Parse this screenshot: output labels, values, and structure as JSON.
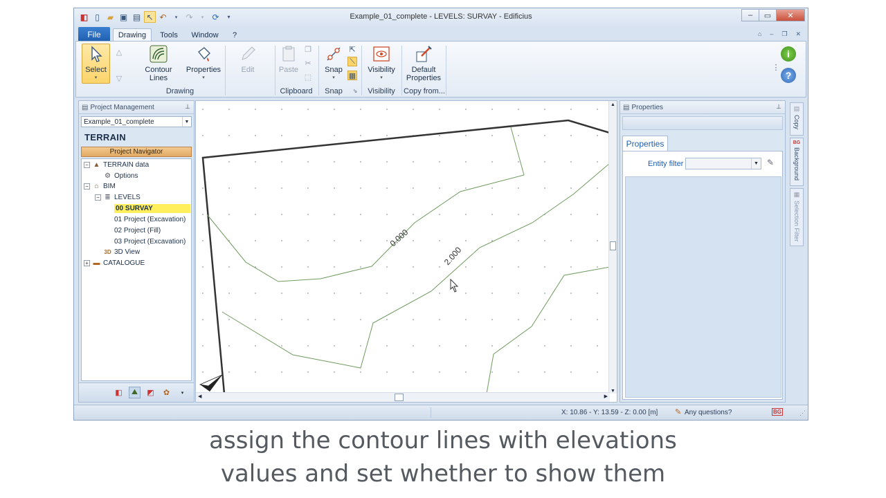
{
  "window": {
    "title": "Example_01_complete -  LEVELS: SURVAY - Edificius"
  },
  "menu": {
    "file": "File",
    "tabs": [
      "Drawing",
      "Tools",
      "Window",
      "?"
    ]
  },
  "ribbon": {
    "select": "Select",
    "contour_lines": "Contour\nLines",
    "properties": "Properties",
    "edit": "Edit",
    "paste": "Paste",
    "snap": "Snap",
    "visibility": "Visibility",
    "default_properties": "Default\nProperties",
    "groups": {
      "drawing": "Drawing",
      "clipboard": "Clipboard",
      "snap": "Snap",
      "visibility": "Visibility",
      "copy_from": "Copy from..."
    }
  },
  "project_panel": {
    "title": "Project Management",
    "project_combo": "Example_01_complete",
    "heading": "TERRAIN",
    "navigator_button": "Project Navigator",
    "tree": {
      "terrain_data": "TERRAIN data",
      "options": "Options",
      "bim": "BIM",
      "levels": "LEVELS",
      "level0": "00 SURVAY",
      "level1": "01 Project (Excavation)",
      "level2": "02 Project (Fill)",
      "level3": "03 Project (Excavation)",
      "view3d": "3D View",
      "catalogue": "CATALOGUE"
    }
  },
  "canvas": {
    "contour_label_1": "0.000",
    "contour_label_2": "2.000"
  },
  "properties_panel": {
    "title": "Properties",
    "tab": "Properties",
    "entity_filter_label": "Entity filter",
    "entity_filter_value": ""
  },
  "side_tabs": {
    "copy": "Copy",
    "background": "Background",
    "selection_filter": "Selection Filter"
  },
  "status": {
    "coords": "X: 10.86 - Y: 13.59 - Z: 0.00 [m]",
    "questions": "Any questions?"
  },
  "caption": {
    "line1": "assign the contour lines with elevations",
    "line2": "values and set whether to show them"
  },
  "colors": {
    "accent": "#1f5fb0",
    "contour": "#6e9a5e",
    "selection": "#ffef5c"
  }
}
